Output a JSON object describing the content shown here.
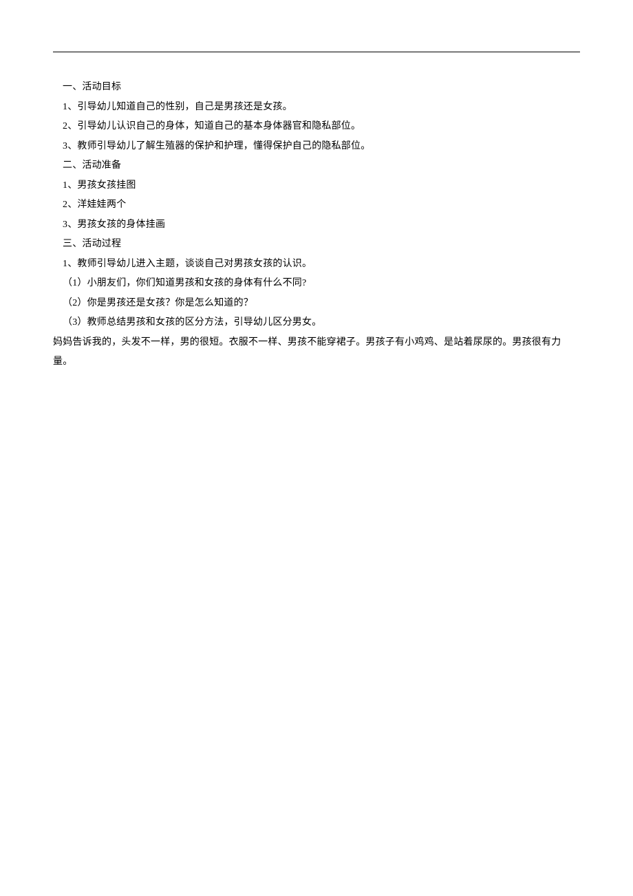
{
  "lines": [
    {
      "text": "一、活动目标",
      "indented": true
    },
    {
      "text": "1、引导幼儿知道自己的性别，自己是男孩还是女孩。",
      "indented": true
    },
    {
      "text": "2、引导幼儿认识自己的身体，知道自己的基本身体器官和隐私部位。",
      "indented": true
    },
    {
      "text": "3、教师引导幼儿了解生殖器的保护和护理，懂得保护自己的隐私部位。",
      "indented": true
    },
    {
      "text": "二、活动准备",
      "indented": true
    },
    {
      "text": "1、男孩女孩挂图",
      "indented": true
    },
    {
      "text": "2、洋娃娃两个",
      "indented": true
    },
    {
      "text": "3、男孩女孩的身体挂画",
      "indented": true
    },
    {
      "text": "三、活动过程",
      "indented": true
    },
    {
      "text": "1、教师引导幼儿进入主题，谈谈自己对男孩女孩的认识。",
      "indented": true
    },
    {
      "text": "（1）小朋友们，你们知道男孩和女孩的身体有什么不同?",
      "indented": true
    },
    {
      "text": "（2）你是男孩还是女孩？你是怎么知道的？",
      "indented": true
    },
    {
      "text": "（3）教师总结男孩和女孩的区分方法，引导幼儿区分男女。",
      "indented": true
    },
    {
      "text": "妈妈告诉我的，头发不一样，男的很短。衣服不一样、男孩不能穿裙子。男孩子有小鸡鸡、是站着尿尿的。男孩很有力",
      "indented": false
    },
    {
      "text": "量。",
      "indented": false
    }
  ]
}
